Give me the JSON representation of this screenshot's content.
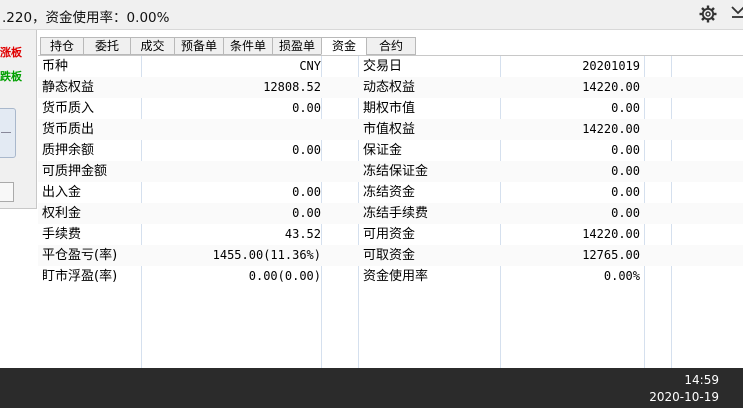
{
  "top_status": ".220，资金使用率：0.00%",
  "left_panel": {
    "rise_label": "涨板",
    "fall_label": "跌板"
  },
  "tabs": [
    {
      "label": "持仓",
      "active": false
    },
    {
      "label": "委托",
      "active": false
    },
    {
      "label": "成交",
      "active": false
    },
    {
      "label": "预备单",
      "active": false
    },
    {
      "label": "条件单",
      "active": false
    },
    {
      "label": "损盈单",
      "active": false
    },
    {
      "label": "资金",
      "active": true
    },
    {
      "label": "合约",
      "active": false
    }
  ],
  "funds": [
    {
      "label1": "币种",
      "value1": "CNY",
      "label2": "交易日",
      "value2": "20201019"
    },
    {
      "label1": "静态权益",
      "value1": "12808.52",
      "label2": "动态权益",
      "value2": "14220.00"
    },
    {
      "label1": "货币质入",
      "value1": "0.00",
      "label2": "期权市值",
      "value2": "0.00"
    },
    {
      "label1": "货币质出",
      "value1": "",
      "label2": "市值权益",
      "value2": "14220.00"
    },
    {
      "label1": "质押余额",
      "value1": "0.00",
      "label2": "保证金",
      "value2": "0.00"
    },
    {
      "label1": "可质押金额",
      "value1": "",
      "label2": "冻结保证金",
      "value2": "0.00"
    },
    {
      "label1": "出入金",
      "value1": "0.00",
      "label2": "冻结资金",
      "value2": "0.00"
    },
    {
      "label1": "权利金",
      "value1": "0.00",
      "label2": "冻结手续费",
      "value2": "0.00"
    },
    {
      "label1": "手续费",
      "value1": "43.52",
      "label2": "可用资金",
      "value2": "14220.00"
    },
    {
      "label1": "平仓盈亏(率)",
      "value1": "1455.00(11.36%)",
      "label2": "可取资金",
      "value2": "12765.00"
    },
    {
      "label1": "盯市浮盈(率)",
      "value1": "0.00(0.00)",
      "label2": "资金使用率",
      "value2": "0.00%"
    }
  ],
  "taskbar": {
    "time": "14:59",
    "date": "2020-10-19"
  },
  "icons": {
    "settings": "gear-icon",
    "corner": "download-arrow-icon"
  },
  "colors": {
    "rise": "#e00000",
    "fall": "#00a000",
    "taskbar": "#2b2b2b",
    "grid_line": "#d5e0ee"
  }
}
